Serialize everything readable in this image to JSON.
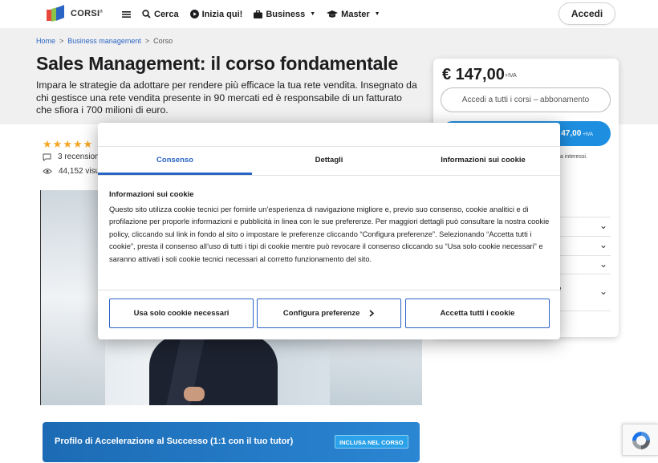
{
  "header": {
    "logo_text": "CORSI",
    "logo_sup": "a",
    "nav": {
      "menu_icon": "hamburger-icon",
      "search": "Cerca",
      "start": "Inizia qui!",
      "business": "Business",
      "master": "Master"
    },
    "login": "Accedi"
  },
  "breadcrumb": {
    "home": "Home",
    "sep1": ">",
    "category": "Business management",
    "sep2": ">",
    "current": "Corso"
  },
  "course": {
    "title": "Sales Management: il corso fondamentale",
    "description": "Impara le strategie da adottare per rendere più efficace la tua rete vendita. Insegnato da chi gestisce una rete vendita presente in 90 mercati ed è responsabile di un fatturato che sfiora i 700 milioni di euro.",
    "rating_stars": 4.5,
    "reviews_label": "3 recensioni",
    "views_label": "44,152 visu"
  },
  "promo": {
    "text": "Profilo di Accelerazione al Successo (1:1 con il tuo tutor)",
    "badge": "INCLUSA NEL CORSO"
  },
  "pricing": {
    "price": "€ 147,00",
    "vat": "+IVA",
    "subscription_btn": "Accedi a tutti i corsi – abbonamento",
    "buy_price": "47,00",
    "buy_vat": "+IVA",
    "note": "a interessi.",
    "accordion_fragment_1": "i",
    "accordion_fragment_2": "e"
  },
  "cookie": {
    "tabs": [
      "Consenso",
      "Dettagli",
      "Informazioni sui cookie"
    ],
    "active_tab": "Consenso",
    "heading": "Informazioni sui cookie",
    "body": "Questo sito utilizza cookie tecnici per fornirle un’esperienza di navigazione migliore e, previo suo consenso, cookie analitici e di profilazione per proporle informazioni e pubblicità in linea con le sue preferenze. Per maggiori dettagli può consultare la nostra cookie policy, cliccando sul link in fondo al sito o impostare le preferenze cliccando “Configura preferenze”. Selezionando “Accetta tutti i cookie”, presta il consenso all’uso di tutti i tipi di cookie mentre può revocare il consenso cliccando su “Usa solo cookie necessari” e saranno attivati i soli cookie tecnici necessari al corretto funzionamento del sito.",
    "btn_necessary": "Usa solo cookie necessari",
    "btn_configure": "Configura preferenze",
    "btn_accept": "Accetta tutti i cookie"
  },
  "colors": {
    "accent": "#2a64c5",
    "buy_button": "#1e8fe0",
    "star": "#f5a623",
    "promo": "#1c6bb4"
  }
}
